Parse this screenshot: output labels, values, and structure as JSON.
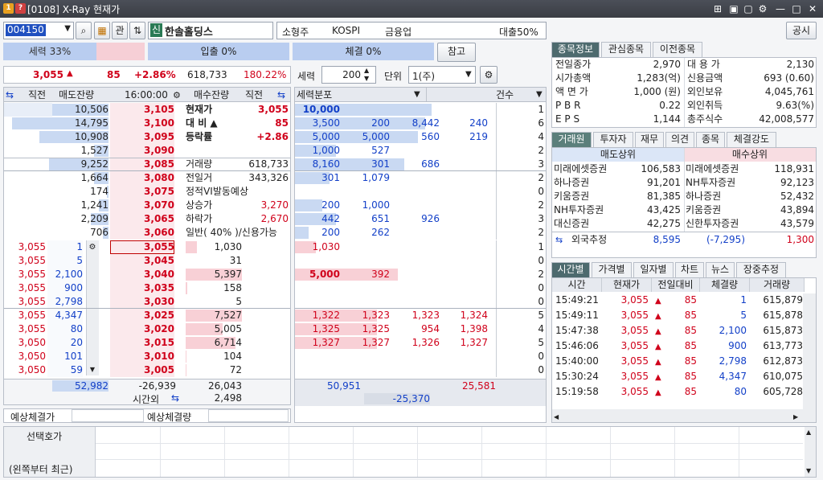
{
  "title": {
    "badge1": "1",
    "badge2": "?",
    "text": "[0108] X-Ray 현재가"
  },
  "window_buttons": [
    "⊞",
    "▣",
    "▢",
    "⚙",
    "—",
    "□",
    "✕"
  ],
  "toolbar": {
    "code": "004150",
    "kan": "관",
    "stock_name": "한솔홀딩스",
    "size": "소형주",
    "market": "KOSPI",
    "sector": "금융업",
    "loan": "대출50%",
    "notice": "공시"
  },
  "bars": {
    "power": "세력 33%",
    "inflow": "입출 0%",
    "execution": "체결 0%",
    "ref": "참고"
  },
  "price_strip": {
    "price": "3,055",
    "arrow": "▲",
    "change": "85",
    "pct": "+2.86%",
    "volume": "618,733",
    "ratio": "180.22%"
  },
  "hoga_header": {
    "prev": "직전",
    "sell_rem": "매도잔량",
    "time": "16:00:00",
    "buy_rem": "매수잔량",
    "prev2": "직전"
  },
  "asks": [
    {
      "rem": "10,506",
      "price": "3,105",
      "bar": 0.7
    },
    {
      "rem": "14,795",
      "price": "3,100",
      "bar": 1.0
    },
    {
      "rem": "10,908",
      "price": "3,095",
      "bar": 0.72
    },
    {
      "rem": "1,527",
      "price": "3,090",
      "bar": 0.15
    },
    {
      "rem": "9,252",
      "price": "3,085",
      "bar": 0.62
    },
    {
      "rem": "1,664",
      "price": "3,080",
      "bar": 0.15
    },
    {
      "rem": "174",
      "price": "3,075",
      "bar": 0.02
    },
    {
      "rem": "1,241",
      "price": "3,070",
      "bar": 0.1
    },
    {
      "rem": "2,209",
      "price": "3,065",
      "bar": 0.18
    },
    {
      "rem": "706",
      "price": "3,060",
      "bar": 0.06
    }
  ],
  "ask_info": [
    {
      "label": "현재가",
      "value": "3,055",
      "bold": true,
      "color": "red"
    },
    {
      "label": "대 비 ▲",
      "value": "85",
      "bold": true,
      "color": "red"
    },
    {
      "label": "등락률",
      "value": "+2.86",
      "bold": true,
      "color": "red"
    },
    {
      "label": "",
      "value": ""
    },
    {
      "label": "거래량",
      "value": "618,733"
    },
    {
      "label": "전일거",
      "value": "343,326"
    },
    {
      "label": "정적VI발동예상",
      "value": ""
    },
    {
      "label": "상승가",
      "value": "3,270",
      "color": "red"
    },
    {
      "label": "하락가",
      "value": "2,670",
      "color": "red"
    },
    {
      "label": "일반( 40% )/신용가능",
      "value": ""
    }
  ],
  "bids": [
    {
      "p1": "3,055",
      "q1": "1",
      "price": "3,055",
      "rem": "1,030",
      "bar": 0.2
    },
    {
      "p1": "3,055",
      "q1": "5",
      "price": "3,045",
      "rem": "31",
      "bar": 0.0
    },
    {
      "p1": "3,055",
      "q1": "2,100",
      "price": "3,040",
      "rem": "5,397",
      "bar": 1.0
    },
    {
      "p1": "3,055",
      "q1": "900",
      "price": "3,035",
      "rem": "158",
      "bar": 0.03
    },
    {
      "p1": "3,055",
      "q1": "2,798",
      "price": "3,030",
      "rem": "5",
      "bar": 0.0
    },
    {
      "p1": "3,055",
      "q1": "4,347",
      "price": "3,025",
      "rem": "7,527",
      "bar": 1.0
    },
    {
      "p1": "3,055",
      "q1": "80",
      "price": "3,020",
      "rem": "5,005",
      "bar": 0.66
    },
    {
      "p1": "3,050",
      "q1": "20",
      "price": "3,015",
      "rem": "6,714",
      "bar": 0.89
    },
    {
      "p1": "3,050",
      "q1": "101",
      "price": "3,010",
      "rem": "104",
      "bar": 0.01
    },
    {
      "p1": "3,050",
      "q1": "59",
      "price": "3,005",
      "rem": "72",
      "bar": 0.01
    }
  ],
  "hoga_totals": {
    "ask_total": "52,982",
    "diff": "-26,939",
    "bid_total": "26,043",
    "after_label": "시간외",
    "after_value": "2,498"
  },
  "expected": {
    "label1": "예상체결가",
    "label2": "예상체결량"
  },
  "dist": {
    "label1": "세력",
    "value1": "200",
    "label2": "단위",
    "unit": "1(주)",
    "header": "세력분포",
    "count_header": "건수"
  },
  "dist_ask_rows": [
    {
      "vals": [
        "10,000",
        "",
        "",
        ""
      ],
      "count": "1",
      "bar": 1.0
    },
    {
      "vals": [
        "3,500",
        "200",
        "8,442",
        "240"
      ],
      "count": "6",
      "bar": 0.95
    },
    {
      "vals": [
        "5,000",
        "5,000",
        "560",
        "219"
      ],
      "count": "4",
      "bar": 0.9
    },
    {
      "vals": [
        "1,000",
        "527",
        "",
        ""
      ],
      "count": "2",
      "bar": 0.3
    },
    {
      "vals": [
        "8,160",
        "301",
        "686",
        ""
      ],
      "count": "3",
      "bar": 0.8
    },
    {
      "vals": [
        "301",
        "1,079",
        "",
        ""
      ],
      "count": "2",
      "bar": 0.25
    },
    {
      "vals": [
        "",
        "",
        "",
        ""
      ],
      "count": "0",
      "bar": 0.0
    },
    {
      "vals": [
        "200",
        "1,000",
        "",
        ""
      ],
      "count": "2",
      "bar": 0.2
    },
    {
      "vals": [
        "442",
        "651",
        "926",
        ""
      ],
      "count": "3",
      "bar": 0.3
    },
    {
      "vals": [
        "200",
        "262",
        "",
        ""
      ],
      "count": "2",
      "bar": 0.1
    }
  ],
  "dist_bid_rows": [
    {
      "vals": [
        "1,030",
        "",
        "",
        ""
      ],
      "count": "1",
      "bar": 0.15
    },
    {
      "vals": [
        "",
        "",
        "",
        ""
      ],
      "count": "0",
      "bar": 0.0
    },
    {
      "vals": [
        "5,000",
        "392",
        "",
        ""
      ],
      "count": "2",
      "bar": 0.75
    },
    {
      "vals": [
        "",
        "",
        "",
        ""
      ],
      "count": "0",
      "bar": 0.0
    },
    {
      "vals": [
        "",
        "",
        "",
        ""
      ],
      "count": "0",
      "bar": 0.0
    },
    {
      "vals": [
        "1,322",
        "1,323",
        "1,323",
        "1,324"
      ],
      "count": "5",
      "bar": 0.6
    },
    {
      "vals": [
        "1,325",
        "1,325",
        "954",
        "1,398"
      ],
      "count": "4",
      "bar": 0.6
    },
    {
      "vals": [
        "1,327",
        "1,327",
        "1,326",
        "1,327"
      ],
      "count": "5",
      "bar": 0.6
    },
    {
      "vals": [
        "",
        "",
        "",
        ""
      ],
      "count": "0",
      "bar": 0.0
    },
    {
      "vals": [
        "",
        "",
        "",
        ""
      ],
      "count": "0",
      "bar": 0.0
    }
  ],
  "dist_totals": {
    "ask": "50,951",
    "bid": "25,581",
    "diff": "-25,370"
  },
  "info_tabs": [
    "종목정보",
    "관심종목",
    "이전종목"
  ],
  "info_rows": [
    {
      "l1": "전일종가",
      "v1": "2,970",
      "l2": "대 용 가",
      "v2": "2,130"
    },
    {
      "l1": "시가총액",
      "v1": "1,283(억)",
      "l2": "신용금액",
      "v2": "693  (0.60)"
    },
    {
      "l1": "액 면 가",
      "v1": "1,000 (원)",
      "l2": "외인보유",
      "v2": "4,045,761"
    },
    {
      "l1": "P B R",
      "v1": "0.22",
      "l2": "외인취득",
      "v2": "9.63(%)"
    },
    {
      "l1": "E P S",
      "v1": "1,144",
      "l2": "총주식수",
      "v2": "42,008,577"
    }
  ],
  "broker_tabs": [
    "거래원",
    "투자자",
    "재무",
    "의견",
    "종목",
    "체결강도"
  ],
  "broker_heads": {
    "sell": "매도상위",
    "buy": "매수상위"
  },
  "brokers": [
    {
      "s": "미래에셋증권",
      "sv": "106,583",
      "b": "미래에셋증권",
      "bv": "118,931"
    },
    {
      "s": "하나증권",
      "sv": "91,201",
      "b": "NH투자증권",
      "bv": "92,123"
    },
    {
      "s": "키움증권",
      "sv": "81,385",
      "b": "하나증권",
      "bv": "52,432"
    },
    {
      "s": "NH투자증권",
      "sv": "43,425",
      "b": "키움증권",
      "bv": "43,894"
    },
    {
      "s": "대신증권",
      "sv": "42,275",
      "b": "신한투자증권",
      "bv": "43,579"
    }
  ],
  "foreign_est": {
    "label": "외국추정",
    "v1": "8,595",
    "v2": "(-7,295)",
    "v3": "1,300"
  },
  "time_tabs": [
    "시간별",
    "가격별",
    "일자별",
    "차트",
    "뉴스",
    "장중추정"
  ],
  "time_heads": [
    "시간",
    "현재가",
    "전일대비",
    "체결량",
    "거래량"
  ],
  "ticks": [
    {
      "t": "15:49:21",
      "p": "3,055",
      "d": "85",
      "q": "1",
      "v": "615,879"
    },
    {
      "t": "15:49:11",
      "p": "3,055",
      "d": "85",
      "q": "5",
      "v": "615,878"
    },
    {
      "t": "15:47:38",
      "p": "3,055",
      "d": "85",
      "q": "2,100",
      "v": "615,873"
    },
    {
      "t": "15:46:06",
      "p": "3,055",
      "d": "85",
      "q": "900",
      "v": "613,773"
    },
    {
      "t": "15:40:00",
      "p": "3,055",
      "d": "85",
      "q": "2,798",
      "v": "612,873"
    },
    {
      "t": "15:30:24",
      "p": "3,055",
      "d": "85",
      "q": "4,347",
      "v": "610,075"
    },
    {
      "t": "15:19:58",
      "p": "3,055",
      "d": "85",
      "q": "80",
      "v": "605,728"
    }
  ],
  "bottom": {
    "label1": "선택호가",
    "label2": "(왼쪽부터 최근)"
  }
}
